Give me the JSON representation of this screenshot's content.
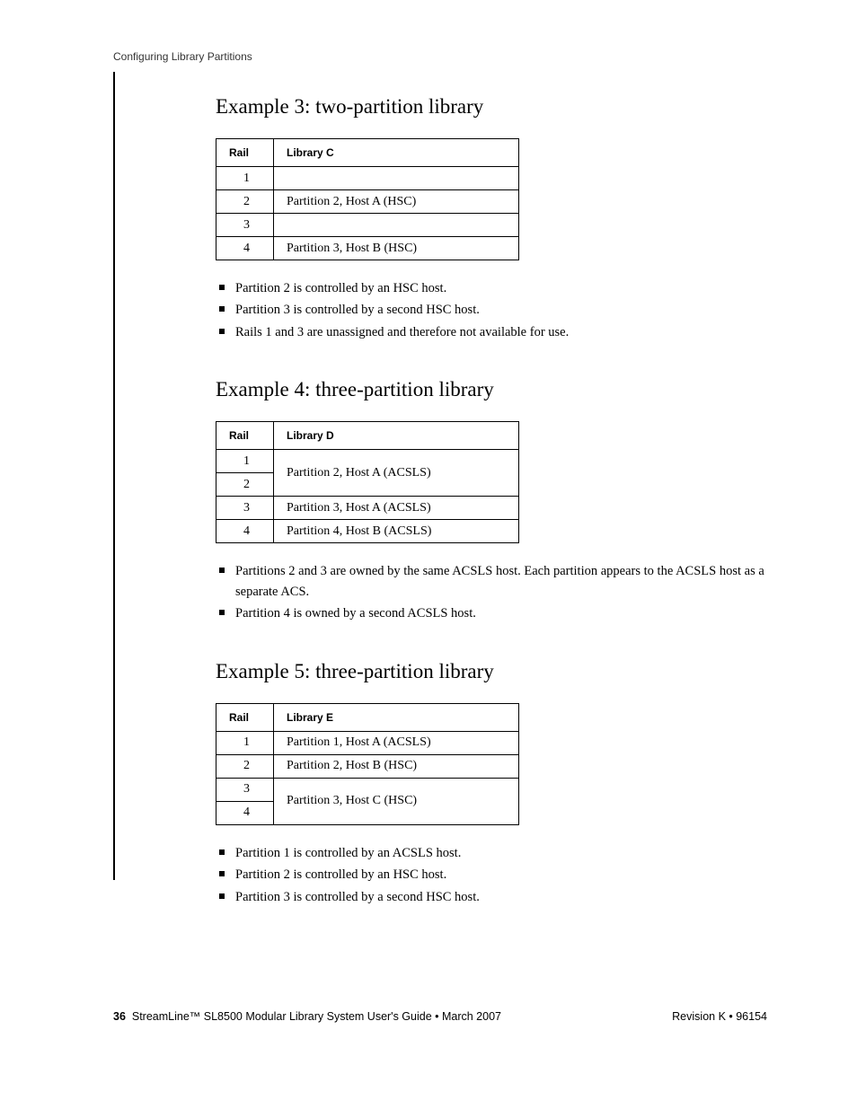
{
  "running_header": "Configuring Library Partitions",
  "example3": {
    "title": "Example 3: two-partition library",
    "table": {
      "headers": [
        "Rail",
        "Library C"
      ],
      "rows": [
        {
          "rail": "1",
          "desc": ""
        },
        {
          "rail": "2",
          "desc": "Partition 2, Host A (HSC)"
        },
        {
          "rail": "3",
          "desc": ""
        },
        {
          "rail": "4",
          "desc": "Partition 3, Host B (HSC)"
        }
      ]
    },
    "bullets": [
      "Partition 2 is controlled by an HSC host.",
      "Partition 3 is controlled by a second HSC host.",
      "Rails 1 and 3 are unassigned and therefore not available for use."
    ]
  },
  "example4": {
    "title": "Example 4: three-partition library",
    "table": {
      "headers": [
        "Rail",
        "Library D"
      ],
      "rows": [
        {
          "rail": "1",
          "desc": "Partition 2, Host A (ACSLS)",
          "rowspan": 2
        },
        {
          "rail": "2"
        },
        {
          "rail": "3",
          "desc": "Partition 3, Host A (ACSLS)"
        },
        {
          "rail": "4",
          "desc": "Partition 4, Host B (ACSLS)"
        }
      ]
    },
    "bullets": [
      "Partitions 2 and 3 are owned by the same ACSLS host. Each partition appears to the ACSLS host as a separate ACS.",
      "Partition 4 is owned by a second ACSLS host."
    ]
  },
  "example5": {
    "title": "Example 5: three-partition library",
    "table": {
      "headers": [
        "Rail",
        "Library E"
      ],
      "rows": [
        {
          "rail": "1",
          "desc": "Partition 1, Host A (ACSLS)"
        },
        {
          "rail": "2",
          "desc": "Partition 2, Host B (HSC)"
        },
        {
          "rail": "3",
          "desc": "Partition 3, Host C (HSC)",
          "rowspan": 2
        },
        {
          "rail": "4"
        }
      ]
    },
    "bullets": [
      "Partition 1 is controlled by an ACSLS host.",
      "Partition 2 is controlled by an HSC host.",
      "Partition 3 is controlled by a second HSC host."
    ]
  },
  "footer": {
    "page_number": "36",
    "doc_title": "StreamLine™ SL8500 Modular Library System User's Guide  •  March 2007",
    "revision": "Revision K  •  96154"
  }
}
